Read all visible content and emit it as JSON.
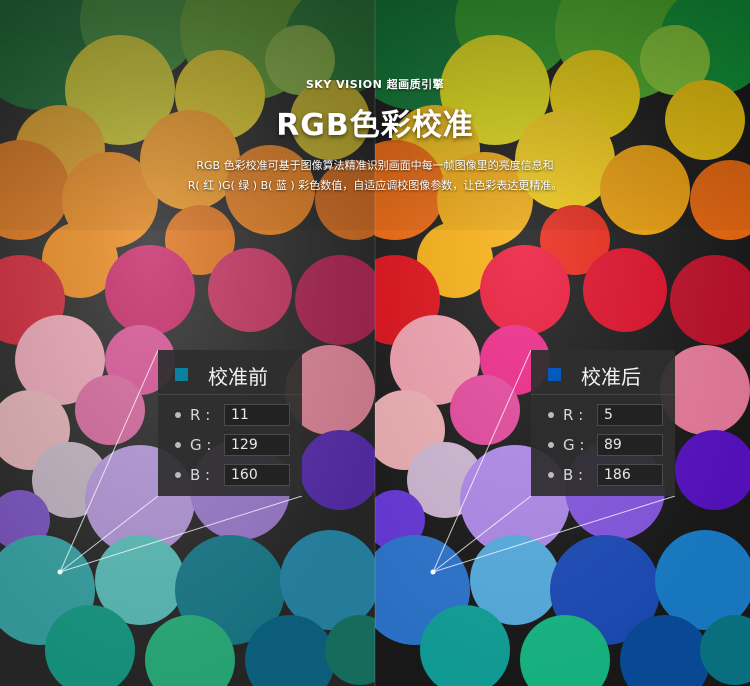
{
  "header": {
    "brand": "SKY VISION 超画质引擎",
    "title": "RGB色彩校准",
    "desc_line1": "RGB 色彩校准可基于图像算法精准识别画面中每一帧图像里的亮度信息和",
    "desc_line2": "R( 红 )G( 绿 ) B( 蓝 ) 彩色数值，自适应调校图像参数，让色彩表达更精准。"
  },
  "panels": {
    "before": {
      "label": "校准前",
      "swatch_color": "#0B81A0",
      "r_label": "R :",
      "g_label": "G :",
      "b_label": "B :",
      "r": "11",
      "g": "129",
      "b": "160"
    },
    "after": {
      "label": "校准后",
      "swatch_color": "#0559BA",
      "r_label": "R :",
      "g_label": "G :",
      "b_label": "B :",
      "r": "5",
      "g": "89",
      "b": "186"
    }
  },
  "colors": {
    "before_tint": "#0b81a0",
    "after_tint": "#0559ba"
  }
}
